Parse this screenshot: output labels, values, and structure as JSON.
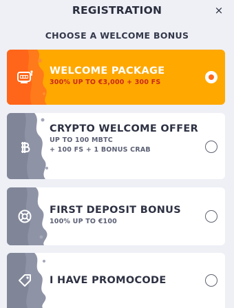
{
  "header": {
    "title": "REGISTRATION",
    "close_label": "×"
  },
  "subtitle": "CHOOSE A WELCOME BONUS",
  "colors": {
    "accent": "#ffa800",
    "accent_text": "#c8291a",
    "background": "#eef0f6"
  },
  "bonuses": [
    {
      "name": "WELCOME PACKAGE",
      "desc_line1": "300% UP TO €3,000 + 300 FS",
      "desc_line2": "",
      "icon": "slot-machine-icon",
      "selected": true
    },
    {
      "name": "CRYPTO WELCOME OFFER",
      "desc_line1": "UP TO 100 MBTC",
      "desc_line2": "+ 100 FS + 1 BONUS CRAB",
      "icon": "bitcoin-icon",
      "selected": false
    },
    {
      "name": "FIRST DEPOSIT BONUS",
      "desc_line1": "100% UP TO €100",
      "desc_line2": "",
      "icon": "lifebuoy-icon",
      "selected": false
    },
    {
      "name": "I HAVE PROMOCODE",
      "desc_line1": "",
      "desc_line2": "",
      "icon": "tag-icon",
      "selected": false
    }
  ]
}
